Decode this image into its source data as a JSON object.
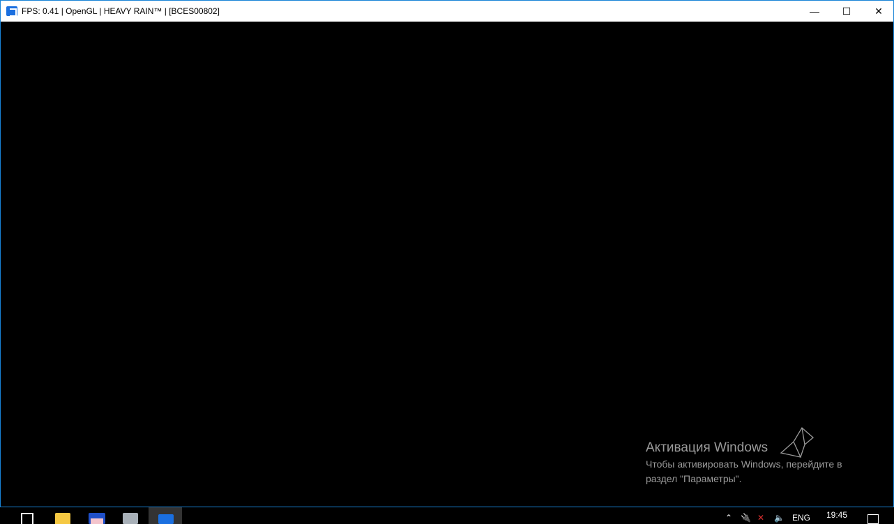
{
  "window": {
    "title": "FPS: 0.41 | OpenGL | HEAVY RAIN™ | [BCES00802]",
    "minimize": "—",
    "maximize": "☐",
    "close": "✕"
  },
  "watermark": {
    "title": "Активация Windows",
    "subtitle": "Чтобы активировать Windows, перейдите в раздел \"Параметры\"."
  },
  "taskbar": {
    "items": [
      "task-view",
      "file-explorer",
      "save-app",
      "resource-monitor",
      "rpcs3"
    ]
  },
  "tray": {
    "language": "ENG",
    "time": "19:45"
  },
  "colors": {
    "accent": "#1883d7"
  }
}
